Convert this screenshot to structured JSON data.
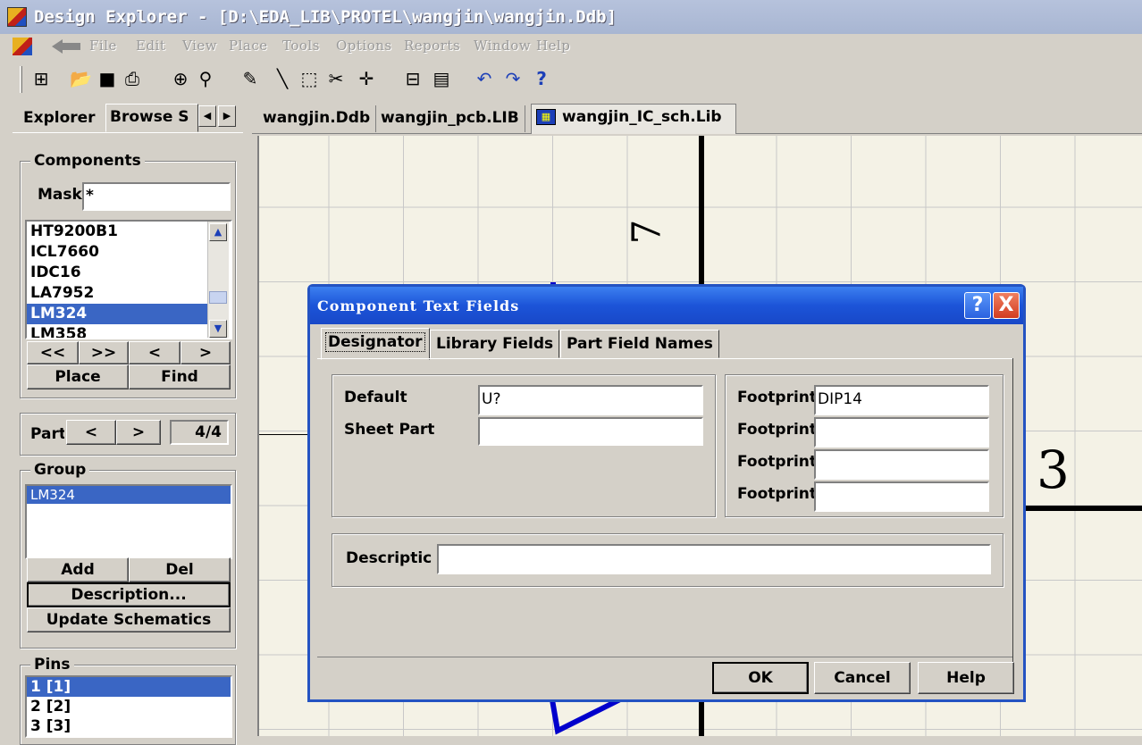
{
  "window": {
    "title": "Design Explorer - [D:\\EDA_LIB\\PROTEL\\wangjin\\wangjin.Ddb]"
  },
  "menu": [
    "File",
    "Edit",
    "View",
    "Place",
    "Tools",
    "Options",
    "Reports",
    "Window",
    "Help"
  ],
  "toolbar": {
    "icons": [
      "explorer-toggle-icon",
      "open-icon",
      "save-icon",
      "print-icon",
      "zoom-in-icon",
      "zoom-out-icon",
      "wire-icon",
      "line-icon",
      "select-icon",
      "cut-icon",
      "move-icon",
      "component-icon",
      "chip-icon",
      "undo-icon",
      "redo-icon",
      "help-icon"
    ]
  },
  "left_panel": {
    "tabs": [
      "Explorer",
      "Browse S"
    ],
    "components": {
      "title": "Components",
      "mask_label": "Mask",
      "mask_value": "*",
      "items": [
        "HT9200B1",
        "ICL7660",
        "IDC16",
        "LA7952",
        "LM324",
        "LM358"
      ],
      "selected": "LM324",
      "nav_buttons": [
        "<<",
        ">>",
        "<",
        ">"
      ],
      "place_label": "Place",
      "find_label": "Find"
    },
    "part": {
      "label": "Part",
      "prev": "<",
      "next": ">",
      "value": "4/4"
    },
    "group": {
      "title": "Group",
      "items": [
        "LM324"
      ],
      "add_label": "Add",
      "del_label": "Del",
      "description_label": "Description...",
      "update_label": "Update Schematics"
    },
    "pins": {
      "title": "Pins",
      "items": [
        "1  [1]",
        "2  [2]",
        "3  [3]"
      ]
    }
  },
  "doc_tabs": [
    "wangjin.Ddb",
    "wangjin_pcb.LIB",
    "wangjin_IC_sch.Lib"
  ],
  "canvas": {
    "pin_numbers": [
      "7",
      "3"
    ]
  },
  "dialog": {
    "title": "Component Text Fields",
    "help_btn": "?",
    "close_btn": "X",
    "tabs": [
      "Designator",
      "Library Fields",
      "Part Field Names"
    ],
    "default_label": "Default",
    "default_value": "U?",
    "sheet_part_label": "Sheet Part",
    "sheet_part_value": "",
    "footprint_label": "Footprint",
    "footprints": [
      "DIP14",
      "",
      "",
      ""
    ],
    "description_label": "Descriptic",
    "description_value": "",
    "ok_label": "OK",
    "cancel_label": "Cancel",
    "help_label": "Help"
  },
  "colors": {
    "title_blue": "#1c54d8",
    "selection": "#3a66c4",
    "schematic_blue": "#0000cc"
  }
}
